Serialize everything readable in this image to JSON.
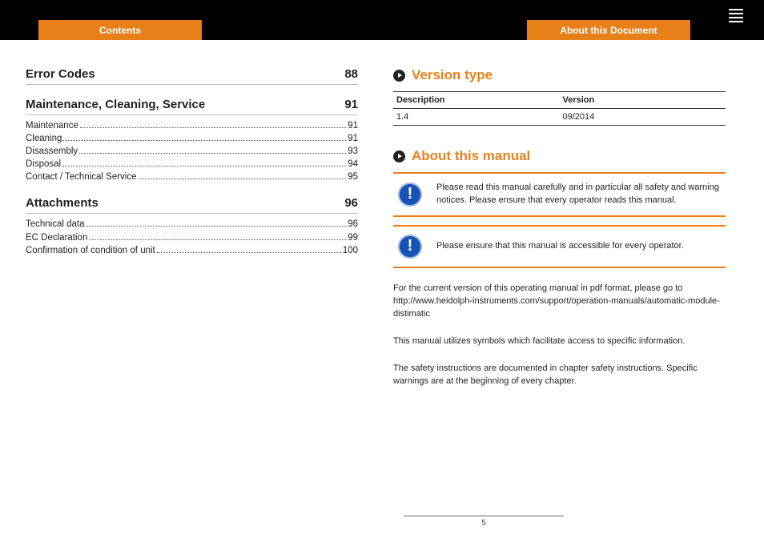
{
  "header": {
    "tab_left": "Contents",
    "tab_right": "About this Document"
  },
  "toc": [
    {
      "title": "Error Codes",
      "page": "88",
      "items": []
    },
    {
      "title": "Maintenance, Cleaning, Service",
      "page": "91",
      "items": [
        {
          "title": "Maintenance",
          "page": "91"
        },
        {
          "title": "Cleaning",
          "page": "91"
        },
        {
          "title": "Disassembly",
          "page": "93"
        },
        {
          "title": "Disposal",
          "page": "94"
        },
        {
          "title": "Contact / Technical Service",
          "page": "95"
        }
      ]
    },
    {
      "title": "Attachments",
      "page": "96",
      "items": [
        {
          "title": "Technical data",
          "page": "96"
        },
        {
          "title": "EC Declaration",
          "page": "99"
        },
        {
          "title": "Confirmation of condition of unit",
          "page": "100"
        }
      ]
    }
  ],
  "right": {
    "version": {
      "heading": "Version type",
      "th_desc": "Description",
      "th_ver": "Version",
      "desc": "1.4",
      "ver": "09/2014"
    },
    "about": {
      "heading": "About this manual",
      "notice1": "Please read this manual carefully and in particular all safety and warning notices. Please ensure that every operator reads this manual.",
      "notice2": "Please ensure that this manual is accessible for every operator.",
      "p1": "For the current version of this operating manual in pdf format, please go to http://www.heidolph-instruments.com/support/operation-manuals/automatic-module-distimatic",
      "p2": "This manual utilizes symbols which facilitate access to specific information.",
      "p3": "The safety instructions are documented in chapter safety instructions. Specific warnings are at the beginning of every chapter."
    }
  },
  "page_number": "5"
}
